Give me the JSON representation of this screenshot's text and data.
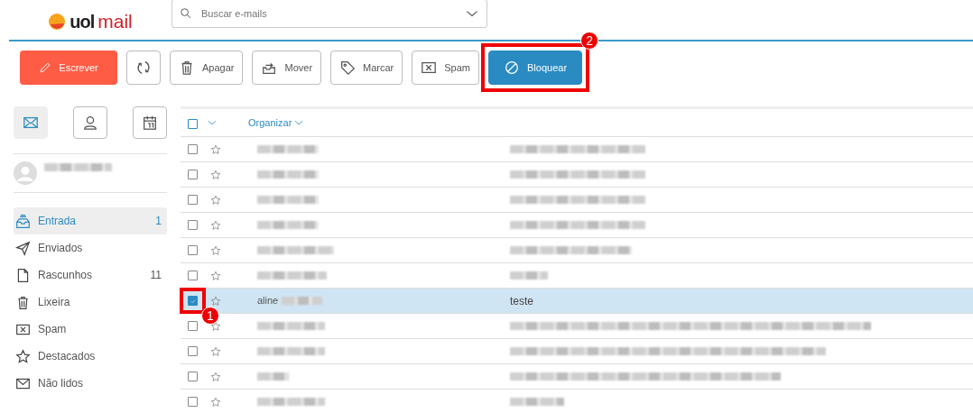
{
  "logo": {
    "brand": "uol",
    "product": "mail"
  },
  "search": {
    "placeholder": "Buscar e-mails"
  },
  "toolbar": {
    "compose": "Escrever",
    "actions": [
      {
        "kind": "trash",
        "label": "Apagar",
        "primary": false
      },
      {
        "kind": "move",
        "label": "Mover",
        "primary": false
      },
      {
        "kind": "tag",
        "label": "Marcar",
        "primary": false
      },
      {
        "kind": "spam",
        "label": "Spam",
        "primary": false
      },
      {
        "kind": "block",
        "label": "Bloquear",
        "primary": true,
        "annotation": "2"
      }
    ]
  },
  "apps": [
    {
      "kind": "mail",
      "selected": true
    },
    {
      "kind": "contacts",
      "selected": false
    },
    {
      "kind": "calendar",
      "selected": false
    }
  ],
  "profile": {
    "email_redacted": true
  },
  "folders": [
    {
      "kind": "inbox",
      "label": "Entrada",
      "count": "1",
      "selected": true
    },
    {
      "kind": "sent",
      "label": "Enviados",
      "selected": false
    },
    {
      "kind": "drafts",
      "label": "Rascunhos",
      "count": "11",
      "selected": false
    },
    {
      "kind": "trash",
      "label": "Lixeira",
      "selected": false
    },
    {
      "kind": "spam",
      "label": "Spam",
      "selected": false
    },
    {
      "kind": "star",
      "label": "Destacados",
      "selected": false
    },
    {
      "kind": "unread",
      "label": "Não lidos",
      "selected": false
    }
  ],
  "list": {
    "sort_label": "Organizar",
    "select_all": false,
    "rows": [
      {
        "redacted": true,
        "checked": false,
        "selected": false
      },
      {
        "redacted": true,
        "checked": false,
        "selected": false
      },
      {
        "redacted": true,
        "checked": false,
        "selected": false
      },
      {
        "redacted": true,
        "checked": false,
        "selected": false
      },
      {
        "redacted": true,
        "checked": false,
        "selected": false
      },
      {
        "redacted": true,
        "checked": false,
        "selected": false
      },
      {
        "sender": "aline",
        "sender_redacted": true,
        "subject": "teste",
        "checked": true,
        "selected": true,
        "annotation": "1"
      },
      {
        "redacted": true,
        "checked": false,
        "selected": false
      },
      {
        "redacted": true,
        "checked": false,
        "selected": false
      },
      {
        "redacted": true,
        "checked": false,
        "selected": false
      },
      {
        "redacted": true,
        "checked": false,
        "selected": false
      }
    ]
  }
}
